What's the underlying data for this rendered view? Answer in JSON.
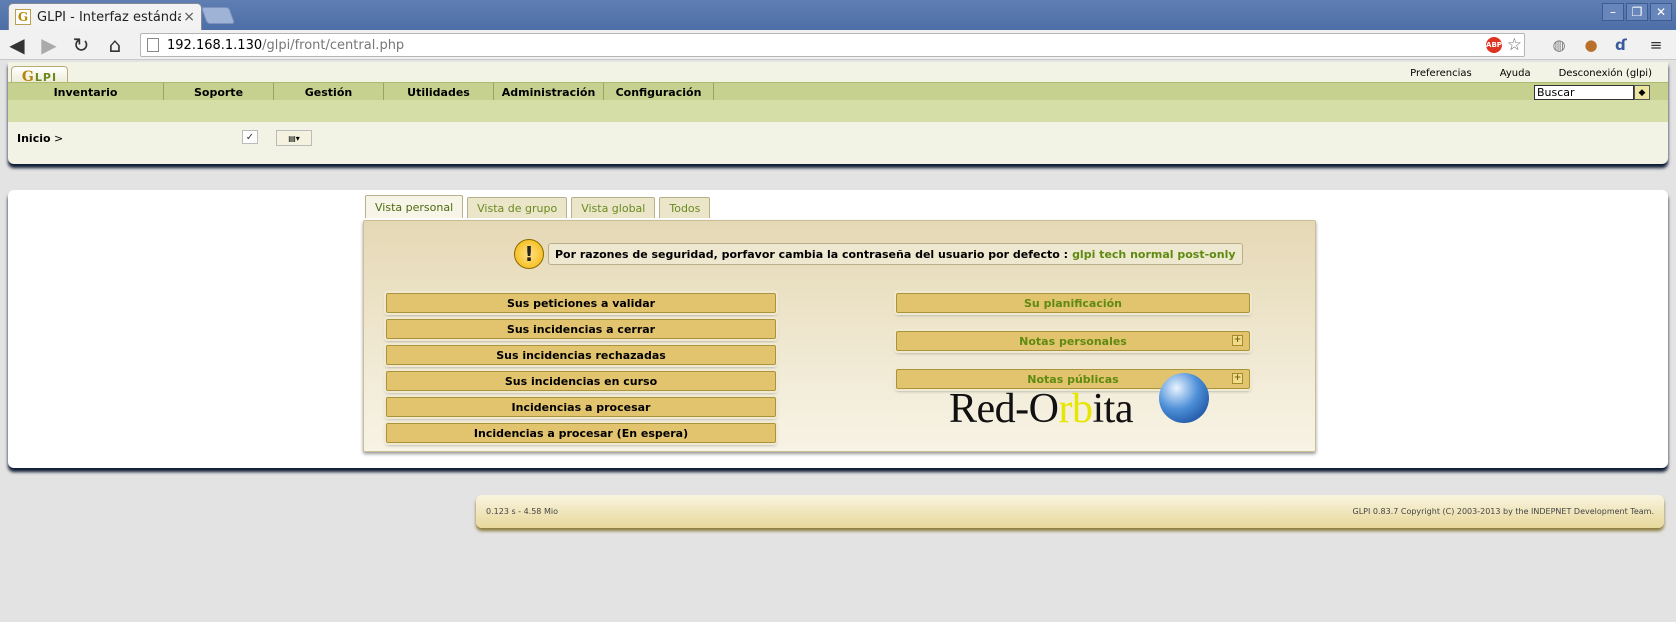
{
  "browser": {
    "tab_title": "GLPI - Interfaz estánda",
    "tab_favicon": "G",
    "tab_close": "×",
    "url_host": "192.168.1.130",
    "url_path": "/glpi/front/central.php",
    "abp_label": "ABP",
    "window_buttons": [
      "–",
      "❐",
      "✕"
    ]
  },
  "header": {
    "logo_text": "G",
    "logo_text2": "LPI",
    "top_links": [
      "Preferencias",
      "Ayuda",
      "Desconexión (glpi)"
    ],
    "menu": [
      "Inventario",
      "Soporte",
      "Gestión",
      "Utilidades",
      "Administración",
      "Configuración"
    ],
    "search_value": "Buscar",
    "breadcrumb_home": "Inicio",
    "breadcrumb_sep": ">"
  },
  "main": {
    "tabs": [
      "Vista personal",
      "Vista de grupo",
      "Vista global",
      "Todos"
    ],
    "warning_text": "Por razones de seguridad, porfavor cambia la contraseña del usuario por defecto :",
    "warning_accounts": "glpi tech normal post-only",
    "left_bars": [
      "Sus peticiones a validar",
      "Sus incidencias a cerrar",
      "Sus incidencias rechazadas",
      "Sus incidencias en curso",
      "Incidencias a procesar",
      "Incidencias a procesar (En espera)"
    ],
    "right_bars": [
      "Su planificación",
      "Notas personales",
      "Notas públicas"
    ],
    "logo_word_a": "Red-O",
    "logo_word_b": "r",
    "logo_word_c": "b",
    "logo_word_d": "ita"
  },
  "footer": {
    "timing": "0.123 s - 4.58 Mio",
    "copyright": "GLPI 0.83.7 Copyright (C) 2003-2013 by the INDEPNET Development Team."
  },
  "colors": {
    "chrome_blue": "#4d6ea6",
    "menu_green": "#c6d190",
    "bar_gold": "#e3c46e",
    "link_green": "#5e8a10"
  }
}
